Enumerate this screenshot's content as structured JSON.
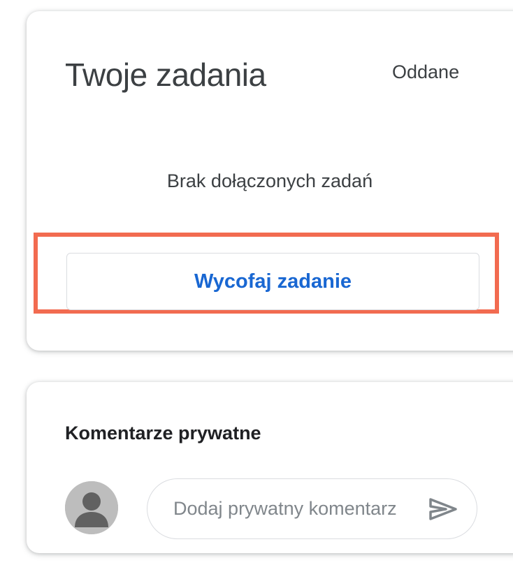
{
  "your_work": {
    "title": "Twoje zadania",
    "status": "Oddane",
    "empty_message": "Brak dołączonych zadań",
    "unsubmit_label": "Wycofaj zadanie"
  },
  "private_comments": {
    "title": "Komentarze prywatne",
    "input_placeholder": "Dodaj prywatny komentarz",
    "input_value": ""
  },
  "icons": {
    "avatar": "person-icon",
    "send": "send-icon"
  },
  "colors": {
    "accent_blue": "#1967d2",
    "highlight": "#f26b50",
    "text_primary": "#3c4043",
    "border": "#dadce0",
    "send_icon": "#80868b",
    "avatar_bg": "#bdbdbd"
  }
}
